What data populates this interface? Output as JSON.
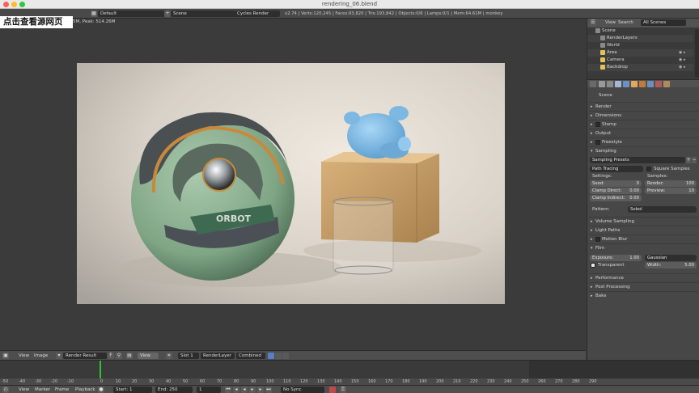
{
  "window": {
    "title": "rendering_06.blend"
  },
  "overlay_label": "点击查看源网页",
  "info_header": {
    "layout_label": "Default",
    "scene_label": "Scene",
    "engine_label": "Cycles Render",
    "stats": "v2.74 | Verts:120,245 | Faces:93,820 | Tris:193,842 | Objects:0/6 | Lamps:0/1 | Mem:64.61M | monkey",
    "memory_line": "5M, Peak: 514.26M"
  },
  "outliner": {
    "header": {
      "view": "View",
      "search": "Search",
      "filter": "All Scenes"
    },
    "items": [
      {
        "label": "Scene",
        "color": "#8a8a8a"
      },
      {
        "label": "RenderLayers",
        "color": "#8a8a8a"
      },
      {
        "label": "World",
        "color": "#8a8a8a"
      },
      {
        "label": "Area",
        "color": "#e1c35a"
      },
      {
        "label": "Camera",
        "color": "#e1c35a"
      },
      {
        "label": "Backdrop",
        "color": "#e1c35a"
      }
    ]
  },
  "properties": {
    "context": "Scene",
    "panels": {
      "render": "Render",
      "dimensions": "Dimensions",
      "stamp": "Stamp",
      "output": "Output",
      "freestyle": "Freestyle",
      "sampling": "Sampling",
      "volume_sampling": "Volume Sampling",
      "light_paths": "Light Paths",
      "motion_blur": "Motion Blur",
      "film": "Film",
      "performance": "Performance",
      "post_processing": "Post Processing",
      "bake": "Bake"
    },
    "sampling": {
      "presets": "Sampling Presets",
      "integrator": "Path Tracing",
      "square_samples": "Square Samples",
      "settings_label": "Settings:",
      "samples_label": "Samples:",
      "seed_label": "Seed:",
      "seed_value": "0",
      "clamp_direct_label": "Clamp Direct:",
      "clamp_direct_value": "0.00",
      "clamp_indirect_label": "Clamp Indirect:",
      "clamp_indirect_value": "0.00",
      "render_label": "Render:",
      "render_value": "100",
      "preview_label": "Preview:",
      "preview_value": "10",
      "pattern_label": "Pattern:",
      "pattern_value": "Sobol"
    },
    "film": {
      "exposure_label": "Exposure:",
      "exposure_value": "1.00",
      "transparent_label": "Transparent",
      "filter_label": "Gaussian",
      "width_label": "Width:",
      "width_value": "5.00"
    }
  },
  "image_header": {
    "view": "View",
    "image": "Image",
    "image_name": "Render Result",
    "view2": "View",
    "slot": "Slot 1",
    "layer": "RenderLayer",
    "pass": "Combined"
  },
  "render_text": "ORBOT",
  "timeline": {
    "ruler_ticks": [
      "-50",
      "-40",
      "-30",
      "-20",
      "-10",
      "0",
      "10",
      "20",
      "30",
      "40",
      "50",
      "60",
      "70",
      "80",
      "90",
      "100",
      "110",
      "120",
      "130",
      "140",
      "150",
      "160",
      "170",
      "180",
      "190",
      "200",
      "210",
      "220",
      "230",
      "240",
      "250",
      "260",
      "270",
      "280",
      "290"
    ],
    "view": "View",
    "marker": "Marker",
    "frame": "Frame",
    "playback": "Playback",
    "start_label": "Start:",
    "start_value": "1",
    "end_label": "End:",
    "end_value": "250",
    "current_frame": "1",
    "sync": "No Sync"
  }
}
